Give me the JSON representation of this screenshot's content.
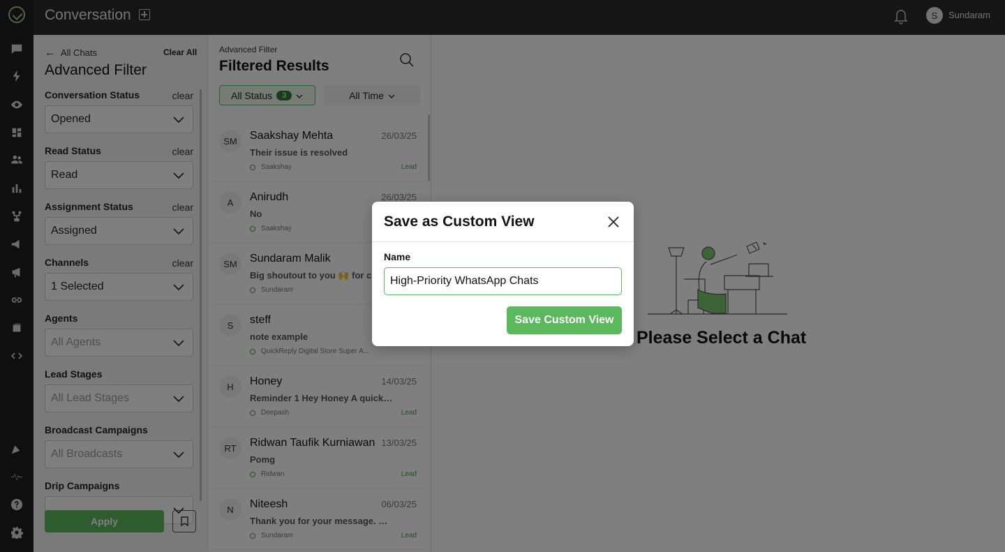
{
  "topbar": {
    "title": "Conversation",
    "user_initial": "S",
    "user_name": "Sundaram"
  },
  "filter_panel": {
    "back_label": "All Chats",
    "clear_all_label": "Clear All",
    "title": "Advanced Filter",
    "clear_label": "clear",
    "groups": [
      {
        "label": "Conversation Status",
        "value": "Opened",
        "placeholder": false,
        "clearable": true
      },
      {
        "label": "Read Status",
        "value": "Read",
        "placeholder": false,
        "clearable": true
      },
      {
        "label": "Assignment Status",
        "value": "Assigned",
        "placeholder": false,
        "clearable": true
      },
      {
        "label": "Channels",
        "value": "1 Selected",
        "placeholder": false,
        "clearable": true
      },
      {
        "label": "Agents",
        "value": "All Agents",
        "placeholder": true,
        "clearable": false
      },
      {
        "label": "Lead Stages",
        "value": "All Lead Stages",
        "placeholder": true,
        "clearable": false
      },
      {
        "label": "Broadcast Campaigns",
        "value": "All Broadcasts",
        "placeholder": true,
        "clearable": false
      },
      {
        "label": "Drip Campaigns",
        "value": "",
        "placeholder": true,
        "clearable": false
      }
    ],
    "apply_label": "Apply"
  },
  "results": {
    "subtitle": "Advanced Filter",
    "title": "Filtered Results",
    "status_filter_label": "All Status",
    "status_filter_count": "3",
    "time_filter_label": "All Time",
    "chats": [
      {
        "initials": "SM",
        "name": "Saakshay Mehta",
        "date": "26/03/25",
        "message": "Their issue is resolved",
        "owner": "Saakshay",
        "stage": "Lead"
      },
      {
        "initials": "A",
        "name": "Anirudh",
        "date": "26/03/25",
        "message": "No",
        "owner": "Saakshay",
        "stage": ""
      },
      {
        "initials": "SM",
        "name": "Sundaram Malik",
        "date": "",
        "message": "Big shoutout to you 🙌 for ch...",
        "owner": "Sundaram",
        "stage": ""
      },
      {
        "initials": "S",
        "name": "steff",
        "date": "",
        "message": "note example",
        "owner": "QuickReply Digital Store Super A...",
        "stage": ""
      },
      {
        "initials": "H",
        "name": "Honey",
        "date": "14/03/25",
        "message": "Reminder 1 Hey Honey A quick r...",
        "owner": "Deepash",
        "stage": "Lead"
      },
      {
        "initials": "RT",
        "name": "Ridwan Taufik Kurniawan",
        "date": "13/03/25",
        "message": "Pomg",
        "owner": "Ridwan",
        "stage": "Lead"
      },
      {
        "initials": "N",
        "name": "Niteesh",
        "date": "06/03/25",
        "message": "Thank you for your message. Th...",
        "owner": "Sundaram",
        "stage": "Lead"
      }
    ]
  },
  "main": {
    "empty_state_text": "Please Select a Chat"
  },
  "modal": {
    "title": "Save as Custom View",
    "name_label": "Name",
    "name_value": "High-Priority WhatsApp Chats",
    "save_label": "Save Custom View"
  },
  "colors": {
    "brand_green": "#5cb85c",
    "dark_rail": "#1f1f1f",
    "topbar": "#2a2a2a"
  }
}
